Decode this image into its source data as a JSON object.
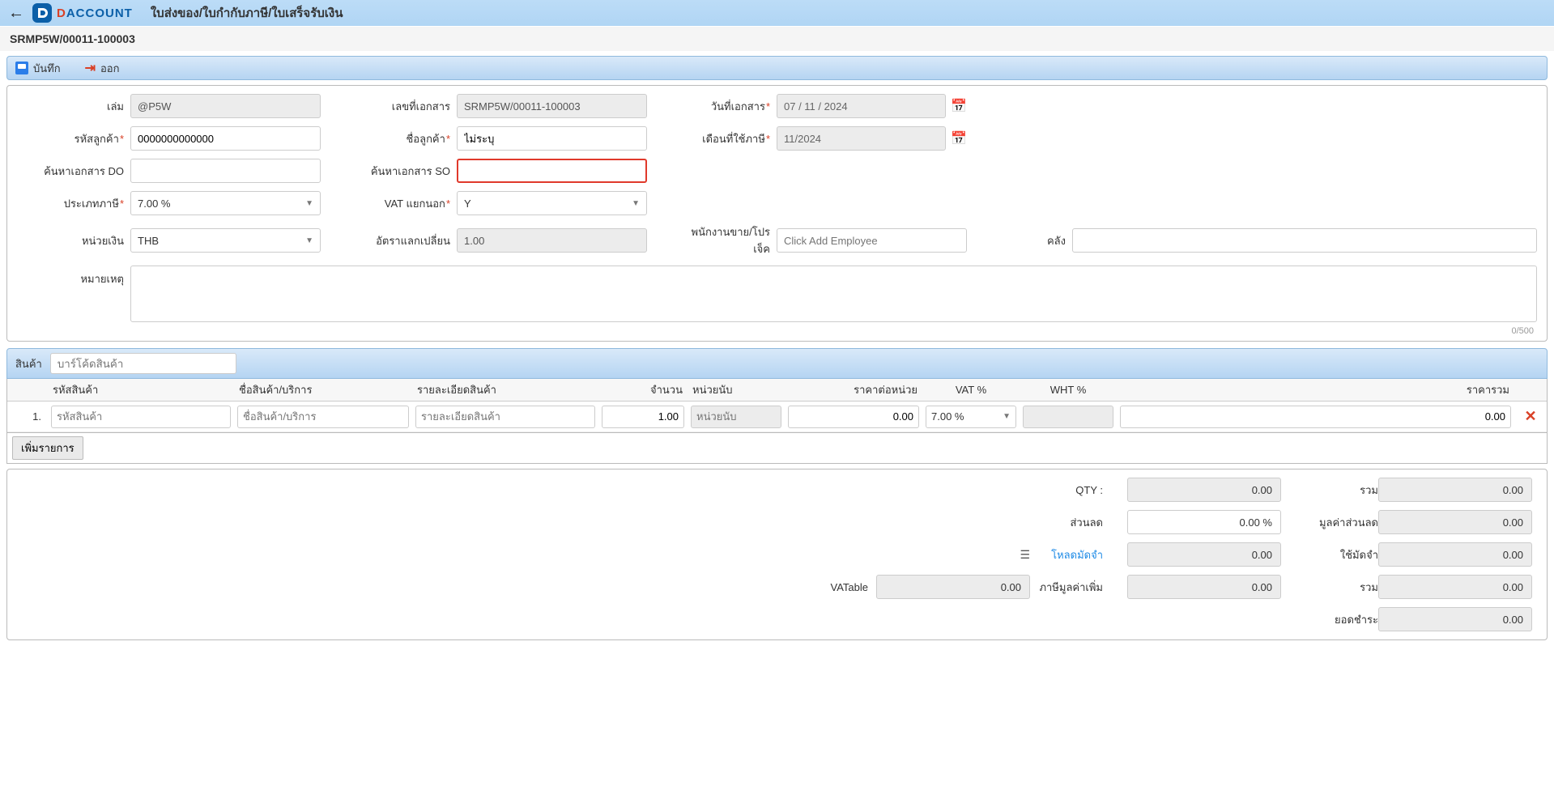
{
  "header": {
    "logo_letter": "D",
    "logo_text_d": "D",
    "logo_text_rest": "ACCOUNT",
    "page_title": "ใบส่งของ/ใบกำกับภาษี/ใบเสร็จรับเงิน"
  },
  "doc_band": "SRMP5W/00011-100003",
  "toolbar": {
    "save": "บันทึก",
    "exit": "ออก"
  },
  "form": {
    "labels": {
      "book": "เล่ม",
      "doc_no": "เลขที่เอกสาร",
      "doc_date": "วันที่เอกสาร",
      "cust_code": "รหัสลูกค้า",
      "cust_name": "ชื่อลูกค้า",
      "tax_month": "เดือนที่ใช้ภาษี",
      "search_do": "ค้นหาเอกสาร DO",
      "search_so": "ค้นหาเอกสาร SO",
      "tax_type": "ประเภทภาษี",
      "vat_sep": "VAT แยกนอก",
      "currency": "หน่วยเงิน",
      "exrate": "อัตราแลกเปลี่ยน",
      "sales": "พนักงานขาย/โปรเจ็ค",
      "warehouse": "คลัง",
      "remark": "หมายเหตุ"
    },
    "values": {
      "book": "@P5W",
      "doc_no": "SRMP5W/00011-100003",
      "doc_date": "07 / 11 / 2024",
      "cust_code": "0000000000000",
      "cust_name": "ไม่ระบุ",
      "tax_month": "11/2024",
      "search_do": "",
      "search_so": "",
      "tax_type": "7.00 %",
      "vat_sep": "Y",
      "currency": "THB",
      "exrate": "1.00",
      "sales_placeholder": "Click Add Employee",
      "warehouse": "",
      "remark": ""
    },
    "char_count": "0/500"
  },
  "items": {
    "band_label": "สินค้า",
    "barcode_placeholder": "บาร์โค้ดสินค้า",
    "columns": {
      "code": "รหัสสินค้า",
      "name": "ชื่อสินค้า/บริการ",
      "detail": "รายละเอียดสินค้า",
      "qty": "จำนวน",
      "unit": "หน่วยนับ",
      "unit_price": "ราคาต่อหน่วย",
      "vat": "VAT %",
      "wht": "WHT %",
      "total": "ราคารวม"
    },
    "row1": {
      "num": "1.",
      "code_ph": "รหัสสินค้า",
      "name_ph": "ชื่อสินค้า/บริการ",
      "detail_ph": "รายละเอียดสินค้า",
      "qty": "1.00",
      "unit_ph": "หน่วยนับ",
      "unit_price": "0.00",
      "vat": "7.00 %",
      "wht": "",
      "total": "0.00"
    },
    "add_label": "เพิ่มรายการ"
  },
  "totals": {
    "qty_lbl": "QTY :",
    "qty_val": "0.00",
    "sum_lbl": "รวม",
    "sum_val": "0.00",
    "discount_lbl": "ส่วนลด",
    "discount_val": "0.00 %",
    "discount_amt_lbl": "มูลค่าส่วนลด",
    "discount_amt_val": "0.00",
    "load_deposit_lbl": "โหลดมัดจำ",
    "load_deposit_val": "0.00",
    "use_deposit_lbl": "ใช้มัดจำ",
    "use_deposit_val": "0.00",
    "vatable_lbl": "VATable",
    "vatable_val": "0.00",
    "vat_lbl": "ภาษีมูลค่าเพิ่ม",
    "vat_val": "0.00",
    "sum2_lbl": "รวม",
    "sum2_val": "0.00",
    "pay_lbl": "ยอดชำระ",
    "pay_val": "0.00"
  }
}
